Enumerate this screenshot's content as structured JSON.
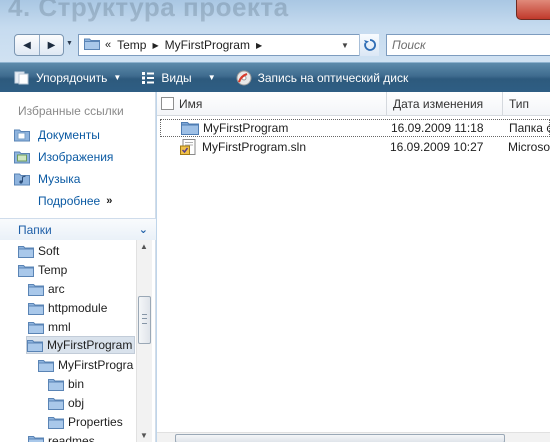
{
  "background_title": "4. Структура проекта",
  "navigation": {
    "back_glyph": "◀",
    "forward_glyph": "▶"
  },
  "address": {
    "overflow_chevron": "«",
    "segments": [
      "Temp",
      "MyFirstProgram"
    ]
  },
  "search": {
    "placeholder": "Поиск"
  },
  "toolbar": {
    "organize_label": "Упорядочить",
    "views_label": "Виды",
    "burn_label": "Запись на оптический диск"
  },
  "nav_pane": {
    "favorites_header": "Избранные ссылки",
    "favorites": [
      {
        "label": "Документы",
        "icon": "documents-icon"
      },
      {
        "label": "Изображения",
        "icon": "pictures-icon"
      },
      {
        "label": "Музыка",
        "icon": "music-icon"
      }
    ],
    "more_label": "Подробнее",
    "more_arrow": "»",
    "folders_header": "Папки",
    "folders_toggle": "⌄",
    "tree": [
      {
        "label": "Soft"
      },
      {
        "label": "Temp"
      },
      {
        "label": "arc"
      },
      {
        "label": "httpmodule"
      },
      {
        "label": "mml"
      },
      {
        "label": "MyFirstProgram",
        "selected": true
      },
      {
        "label": "MyFirstProgra"
      },
      {
        "label": "bin"
      },
      {
        "label": "obj"
      },
      {
        "label": "Properties"
      },
      {
        "label": "readmes"
      }
    ]
  },
  "columns": {
    "name": "Имя",
    "date_modified": "Дата изменения",
    "type": "Тип"
  },
  "files": [
    {
      "name": "MyFirstProgram",
      "date": "16.09.2009 11:18",
      "type": "Папка с файлами",
      "icon": "folder-icon",
      "focused": true
    },
    {
      "name": "MyFirstProgram.sln",
      "date": "16.09.2009 10:27",
      "type": "Microsoft Visual Studio Solution",
      "icon": "solution-file-icon",
      "focused": false
    }
  ],
  "colors": {
    "toolbar": "#3e6b8e",
    "link": "#0b5aa3",
    "folder": "#7ea6d6"
  }
}
